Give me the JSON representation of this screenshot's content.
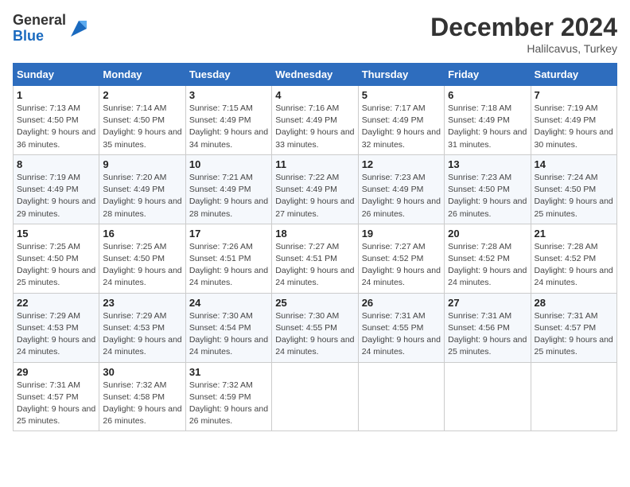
{
  "header": {
    "logo_line1": "General",
    "logo_line2": "Blue",
    "month": "December 2024",
    "location": "Halilcavus, Turkey"
  },
  "weekdays": [
    "Sunday",
    "Monday",
    "Tuesday",
    "Wednesday",
    "Thursday",
    "Friday",
    "Saturday"
  ],
  "weeks": [
    [
      {
        "day": "1",
        "sunrise": "7:13 AM",
        "sunset": "4:50 PM",
        "daylight": "9 hours and 36 minutes."
      },
      {
        "day": "2",
        "sunrise": "7:14 AM",
        "sunset": "4:50 PM",
        "daylight": "9 hours and 35 minutes."
      },
      {
        "day": "3",
        "sunrise": "7:15 AM",
        "sunset": "4:49 PM",
        "daylight": "9 hours and 34 minutes."
      },
      {
        "day": "4",
        "sunrise": "7:16 AM",
        "sunset": "4:49 PM",
        "daylight": "9 hours and 33 minutes."
      },
      {
        "day": "5",
        "sunrise": "7:17 AM",
        "sunset": "4:49 PM",
        "daylight": "9 hours and 32 minutes."
      },
      {
        "day": "6",
        "sunrise": "7:18 AM",
        "sunset": "4:49 PM",
        "daylight": "9 hours and 31 minutes."
      },
      {
        "day": "7",
        "sunrise": "7:19 AM",
        "sunset": "4:49 PM",
        "daylight": "9 hours and 30 minutes."
      }
    ],
    [
      {
        "day": "8",
        "sunrise": "7:19 AM",
        "sunset": "4:49 PM",
        "daylight": "9 hours and 29 minutes."
      },
      {
        "day": "9",
        "sunrise": "7:20 AM",
        "sunset": "4:49 PM",
        "daylight": "9 hours and 28 minutes."
      },
      {
        "day": "10",
        "sunrise": "7:21 AM",
        "sunset": "4:49 PM",
        "daylight": "9 hours and 28 minutes."
      },
      {
        "day": "11",
        "sunrise": "7:22 AM",
        "sunset": "4:49 PM",
        "daylight": "9 hours and 27 minutes."
      },
      {
        "day": "12",
        "sunrise": "7:23 AM",
        "sunset": "4:49 PM",
        "daylight": "9 hours and 26 minutes."
      },
      {
        "day": "13",
        "sunrise": "7:23 AM",
        "sunset": "4:50 PM",
        "daylight": "9 hours and 26 minutes."
      },
      {
        "day": "14",
        "sunrise": "7:24 AM",
        "sunset": "4:50 PM",
        "daylight": "9 hours and 25 minutes."
      }
    ],
    [
      {
        "day": "15",
        "sunrise": "7:25 AM",
        "sunset": "4:50 PM",
        "daylight": "9 hours and 25 minutes."
      },
      {
        "day": "16",
        "sunrise": "7:25 AM",
        "sunset": "4:50 PM",
        "daylight": "9 hours and 24 minutes."
      },
      {
        "day": "17",
        "sunrise": "7:26 AM",
        "sunset": "4:51 PM",
        "daylight": "9 hours and 24 minutes."
      },
      {
        "day": "18",
        "sunrise": "7:27 AM",
        "sunset": "4:51 PM",
        "daylight": "9 hours and 24 minutes."
      },
      {
        "day": "19",
        "sunrise": "7:27 AM",
        "sunset": "4:52 PM",
        "daylight": "9 hours and 24 minutes."
      },
      {
        "day": "20",
        "sunrise": "7:28 AM",
        "sunset": "4:52 PM",
        "daylight": "9 hours and 24 minutes."
      },
      {
        "day": "21",
        "sunrise": "7:28 AM",
        "sunset": "4:52 PM",
        "daylight": "9 hours and 24 minutes."
      }
    ],
    [
      {
        "day": "22",
        "sunrise": "7:29 AM",
        "sunset": "4:53 PM",
        "daylight": "9 hours and 24 minutes."
      },
      {
        "day": "23",
        "sunrise": "7:29 AM",
        "sunset": "4:53 PM",
        "daylight": "9 hours and 24 minutes."
      },
      {
        "day": "24",
        "sunrise": "7:30 AM",
        "sunset": "4:54 PM",
        "daylight": "9 hours and 24 minutes."
      },
      {
        "day": "25",
        "sunrise": "7:30 AM",
        "sunset": "4:55 PM",
        "daylight": "9 hours and 24 minutes."
      },
      {
        "day": "26",
        "sunrise": "7:31 AM",
        "sunset": "4:55 PM",
        "daylight": "9 hours and 24 minutes."
      },
      {
        "day": "27",
        "sunrise": "7:31 AM",
        "sunset": "4:56 PM",
        "daylight": "9 hours and 25 minutes."
      },
      {
        "day": "28",
        "sunrise": "7:31 AM",
        "sunset": "4:57 PM",
        "daylight": "9 hours and 25 minutes."
      }
    ],
    [
      {
        "day": "29",
        "sunrise": "7:31 AM",
        "sunset": "4:57 PM",
        "daylight": "9 hours and 25 minutes."
      },
      {
        "day": "30",
        "sunrise": "7:32 AM",
        "sunset": "4:58 PM",
        "daylight": "9 hours and 26 minutes."
      },
      {
        "day": "31",
        "sunrise": "7:32 AM",
        "sunset": "4:59 PM",
        "daylight": "9 hours and 26 minutes."
      },
      null,
      null,
      null,
      null
    ]
  ]
}
